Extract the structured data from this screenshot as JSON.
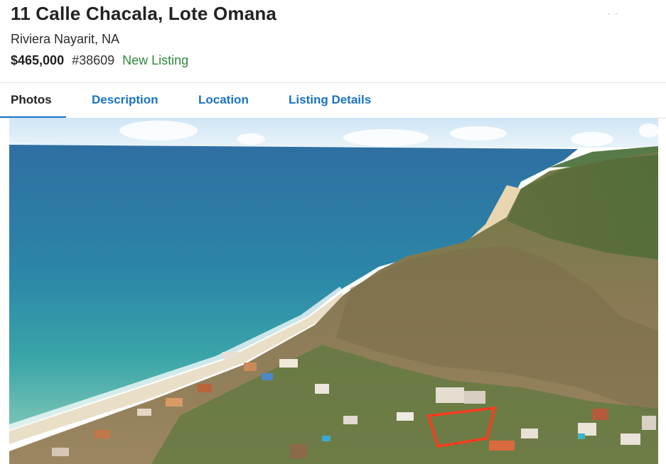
{
  "listing": {
    "title": "11 Calle Chacala, Lote Omana",
    "location": "Riviera Nayarit, NA",
    "price": "$465,000",
    "mls_number": "#38609",
    "status": "New Listing"
  },
  "tabs": [
    {
      "label": "Photos",
      "active": true
    },
    {
      "label": "Description",
      "active": false
    },
    {
      "label": "Location",
      "active": false
    },
    {
      "label": "Listing Details",
      "active": false
    }
  ],
  "colors": {
    "accent": "#1a73c2",
    "status_green": "#2f8a3a",
    "lot_outline": "#ff3b1f"
  }
}
